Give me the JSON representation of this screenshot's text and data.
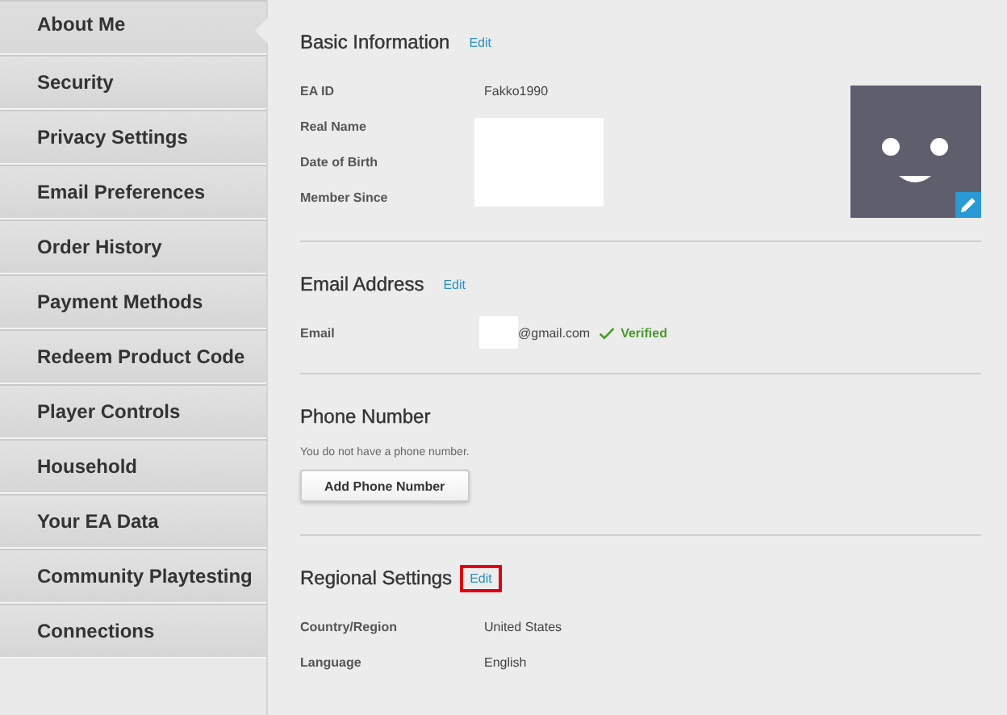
{
  "sidebar": {
    "items": [
      {
        "label": "About Me",
        "selected": true
      },
      {
        "label": "Security",
        "selected": false
      },
      {
        "label": "Privacy Settings",
        "selected": false
      },
      {
        "label": "Email Preferences",
        "selected": false
      },
      {
        "label": "Order History",
        "selected": false
      },
      {
        "label": "Payment Methods",
        "selected": false
      },
      {
        "label": "Redeem Product Code",
        "selected": false
      },
      {
        "label": "Player Controls",
        "selected": false
      },
      {
        "label": "Household",
        "selected": false
      },
      {
        "label": "Your EA Data",
        "selected": false
      },
      {
        "label": "Community Playtesting",
        "selected": false
      },
      {
        "label": "Connections",
        "selected": false
      }
    ]
  },
  "sections": [
    {
      "title": "Basic Information",
      "edit": "Edit",
      "avatar": true,
      "rows": [
        {
          "label": "EA ID",
          "value": "Fakko1990"
        },
        {
          "label": "Real Name",
          "redacted": true
        },
        {
          "label": "Date of Birth",
          "redacted": true
        },
        {
          "label": "Member Since",
          "redacted": true
        }
      ]
    },
    {
      "title": "Email Address",
      "edit": "Edit",
      "rows": [
        {
          "label": "Email",
          "value": "@gmail.com",
          "redacted_prefix": true,
          "status": "Verified"
        }
      ]
    },
    {
      "title": "Phone Number",
      "note": "You do not have a phone number.",
      "button": "Add Phone Number"
    },
    {
      "title": "Regional Settings",
      "edit": "Edit",
      "edit_highlighted": true,
      "rows": [
        {
          "label": "Country/Region",
          "value": "United States"
        },
        {
          "label": "Language",
          "value": "English"
        }
      ]
    }
  ]
}
